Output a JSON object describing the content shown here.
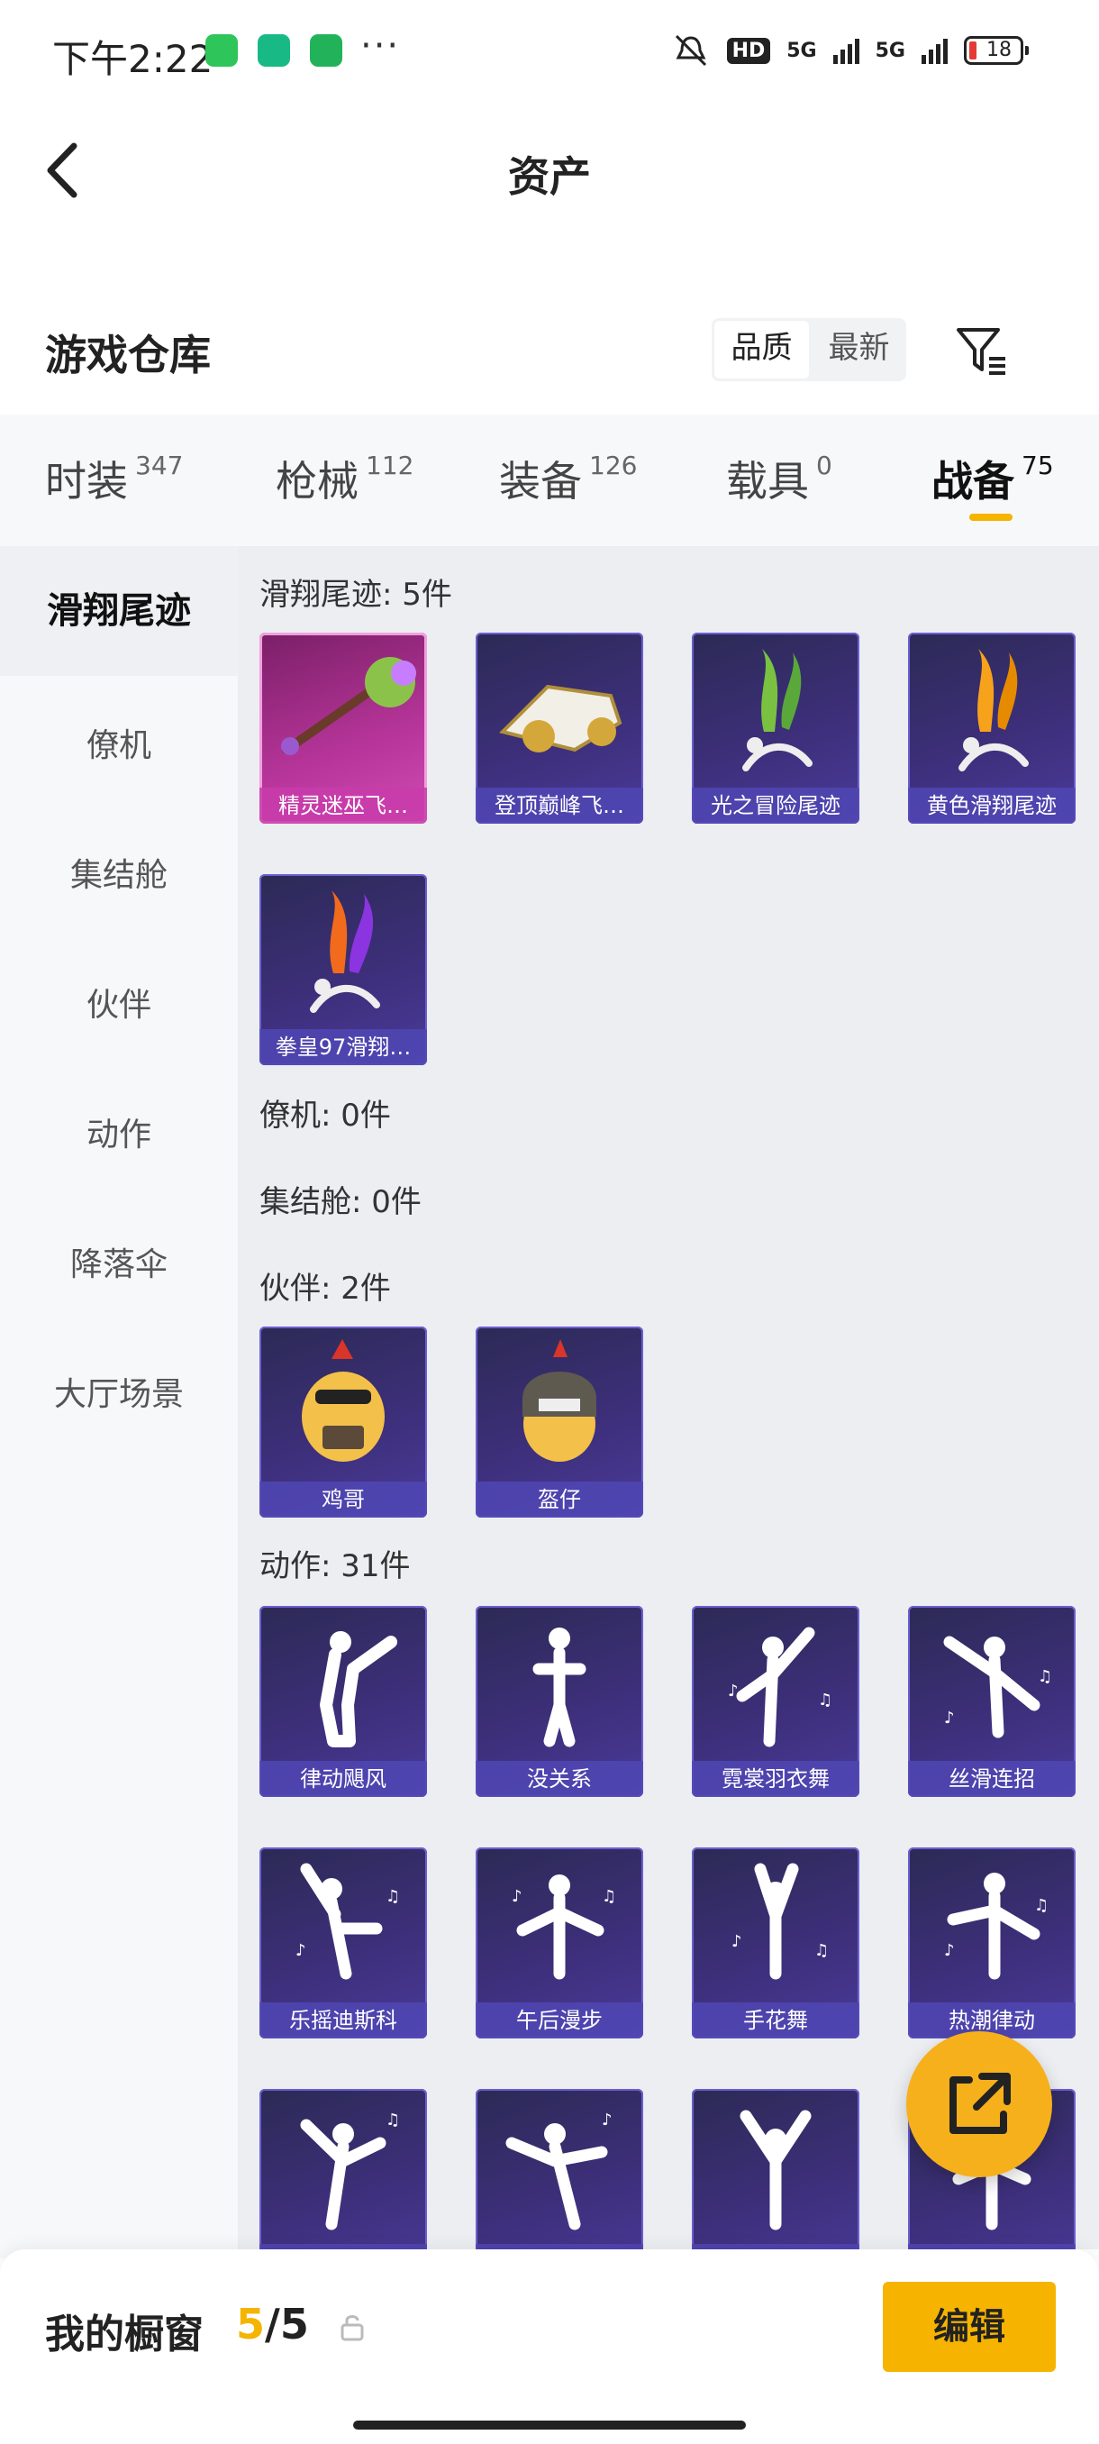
{
  "status_bar": {
    "time": "下午2:22",
    "network1": "5G",
    "network2": "5G",
    "hd_label": "HD",
    "battery": "18",
    "more": "···"
  },
  "header": {
    "title": "资产"
  },
  "section": {
    "title": "游戏仓库",
    "sort_options": [
      "品质",
      "最新"
    ],
    "active_sort": 0
  },
  "tabs": [
    {
      "label": "时装",
      "count": "347"
    },
    {
      "label": "枪械",
      "count": "112"
    },
    {
      "label": "装备",
      "count": "126"
    },
    {
      "label": "载具",
      "count": "0"
    },
    {
      "label": "战备",
      "count": "75"
    }
  ],
  "active_tab": 4,
  "sidebar": {
    "items": [
      {
        "label": "滑翔尾迹"
      },
      {
        "label": "僚机"
      },
      {
        "label": "集结舱"
      },
      {
        "label": "伙伴"
      },
      {
        "label": "动作"
      },
      {
        "label": "降落伞"
      },
      {
        "label": "大厅场景"
      }
    ],
    "active": 0
  },
  "groups": {
    "trails": {
      "title": "滑翔尾迹: 5件",
      "items": [
        "精灵迷巫飞…",
        "登顶巅峰飞…",
        "光之冒险尾迹",
        "黄色滑翔尾迹",
        "拳皇97滑翔…"
      ]
    },
    "wingman": {
      "title": "僚机: 0件"
    },
    "pod": {
      "title": "集结舱: 0件"
    },
    "partner": {
      "title": "伙伴: 2件",
      "items": [
        "鸡哥",
        "盔仔"
      ]
    },
    "emote": {
      "title": "动作: 31件",
      "items": [
        "律动飓风",
        "没关系",
        "霓裳羽衣舞",
        "丝滑连招",
        "乐摇迪斯科",
        "午后漫步",
        "手花舞",
        "热潮律动",
        "",
        "",
        "",
        ""
      ]
    }
  },
  "bottom": {
    "window_label": "我的橱窗",
    "count_current": "5",
    "count_total": "/5",
    "edit_label": "编辑"
  },
  "colors": {
    "accent": "#f6b400",
    "card_purple": "#3d2f7a",
    "card_pink": "#b7359a"
  },
  "icons": {
    "back": "chevron-left-icon",
    "filter": "filter-icon",
    "share": "share-external-icon",
    "lock": "lock-icon"
  }
}
